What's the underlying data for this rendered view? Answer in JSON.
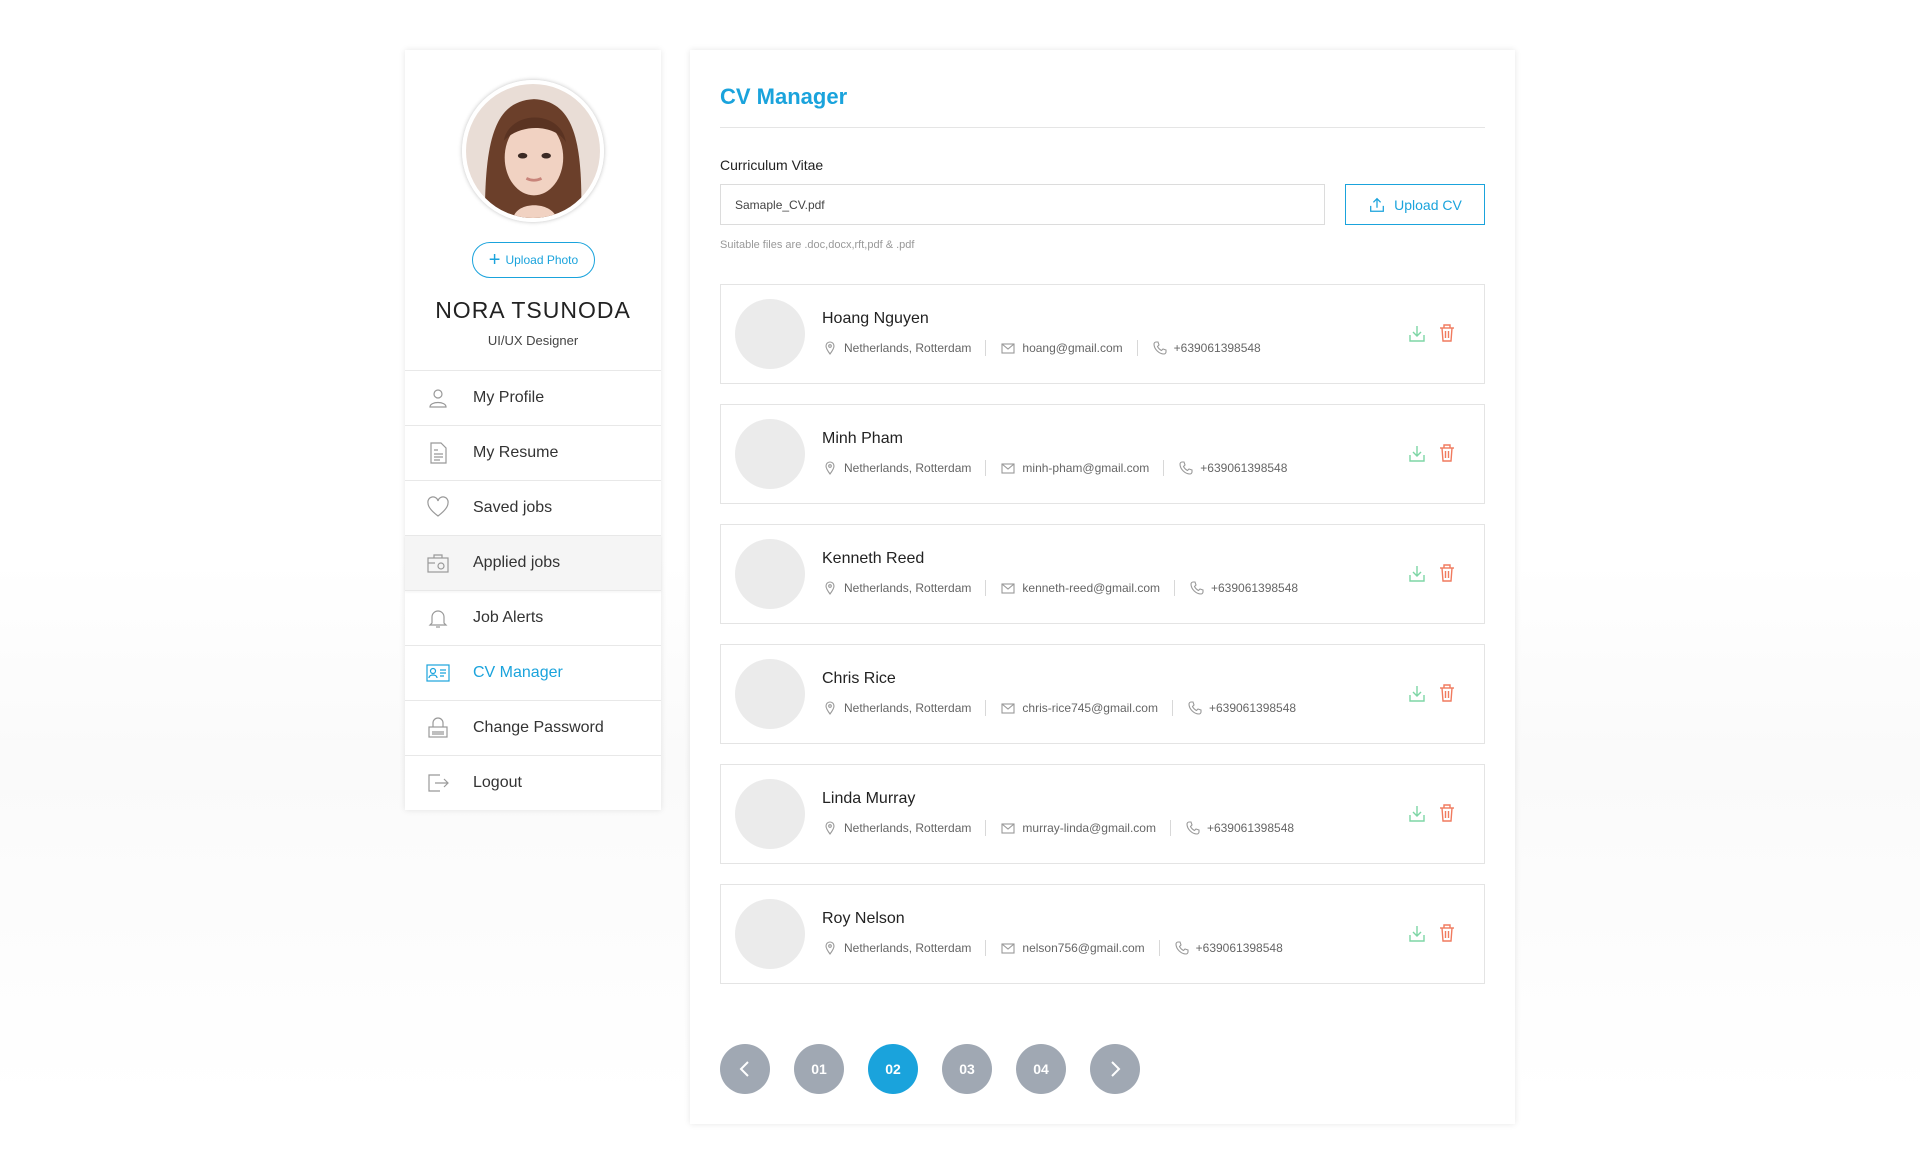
{
  "sidebar": {
    "upload_photo_label": "Upload Photo",
    "user_name": "NORA TSUNODA",
    "user_role": "UI/UX Designer",
    "menu": [
      {
        "label": "My Profile",
        "icon": "user-icon"
      },
      {
        "label": "My Resume",
        "icon": "document-icon"
      },
      {
        "label": "Saved jobs",
        "icon": "heart-icon"
      },
      {
        "label": "Applied jobs",
        "icon": "briefcase-icon"
      },
      {
        "label": "Job Alerts",
        "icon": "bell-icon"
      },
      {
        "label": "CV Manager",
        "icon": "id-card-icon",
        "active": true
      },
      {
        "label": "Change Password",
        "icon": "lock-icon"
      },
      {
        "label": "Logout",
        "icon": "logout-icon"
      }
    ]
  },
  "main": {
    "title": "CV Manager",
    "cv_label": "Curriculum Vitae",
    "cv_file_value": "Samaple_CV.pdf",
    "upload_cv_label": "Upload CV",
    "hint": "Suitable files are .doc,docx,rft,pdf & .pdf"
  },
  "candidates": [
    {
      "name": "Hoang Nguyen",
      "location": "Netherlands, Rotterdam",
      "email": "hoang@gmail.com",
      "phone": "+639061398548"
    },
    {
      "name": "Minh Pham",
      "location": "Netherlands, Rotterdam",
      "email": "minh-pham@gmail.com",
      "phone": "+639061398548"
    },
    {
      "name": "Kenneth Reed",
      "location": "Netherlands, Rotterdam",
      "email": "kenneth-reed@gmail.com",
      "phone": "+639061398548"
    },
    {
      "name": "Chris Rice",
      "location": "Netherlands, Rotterdam",
      "email": "chris-rice745@gmail.com",
      "phone": "+639061398548"
    },
    {
      "name": "Linda Murray",
      "location": "Netherlands, Rotterdam",
      "email": "murray-linda@gmail.com",
      "phone": "+639061398548"
    },
    {
      "name": "Roy Nelson",
      "location": "Netherlands, Rotterdam",
      "email": "nelson756@gmail.com",
      "phone": "+639061398548"
    }
  ],
  "pagination": {
    "pages": [
      "01",
      "02",
      "03",
      "04"
    ],
    "current": "02"
  },
  "colors": {
    "accent": "#1aa3dc",
    "download": "#7ed6a6",
    "delete": "#f07a5e",
    "pager_inactive": "#a0a8b3"
  }
}
